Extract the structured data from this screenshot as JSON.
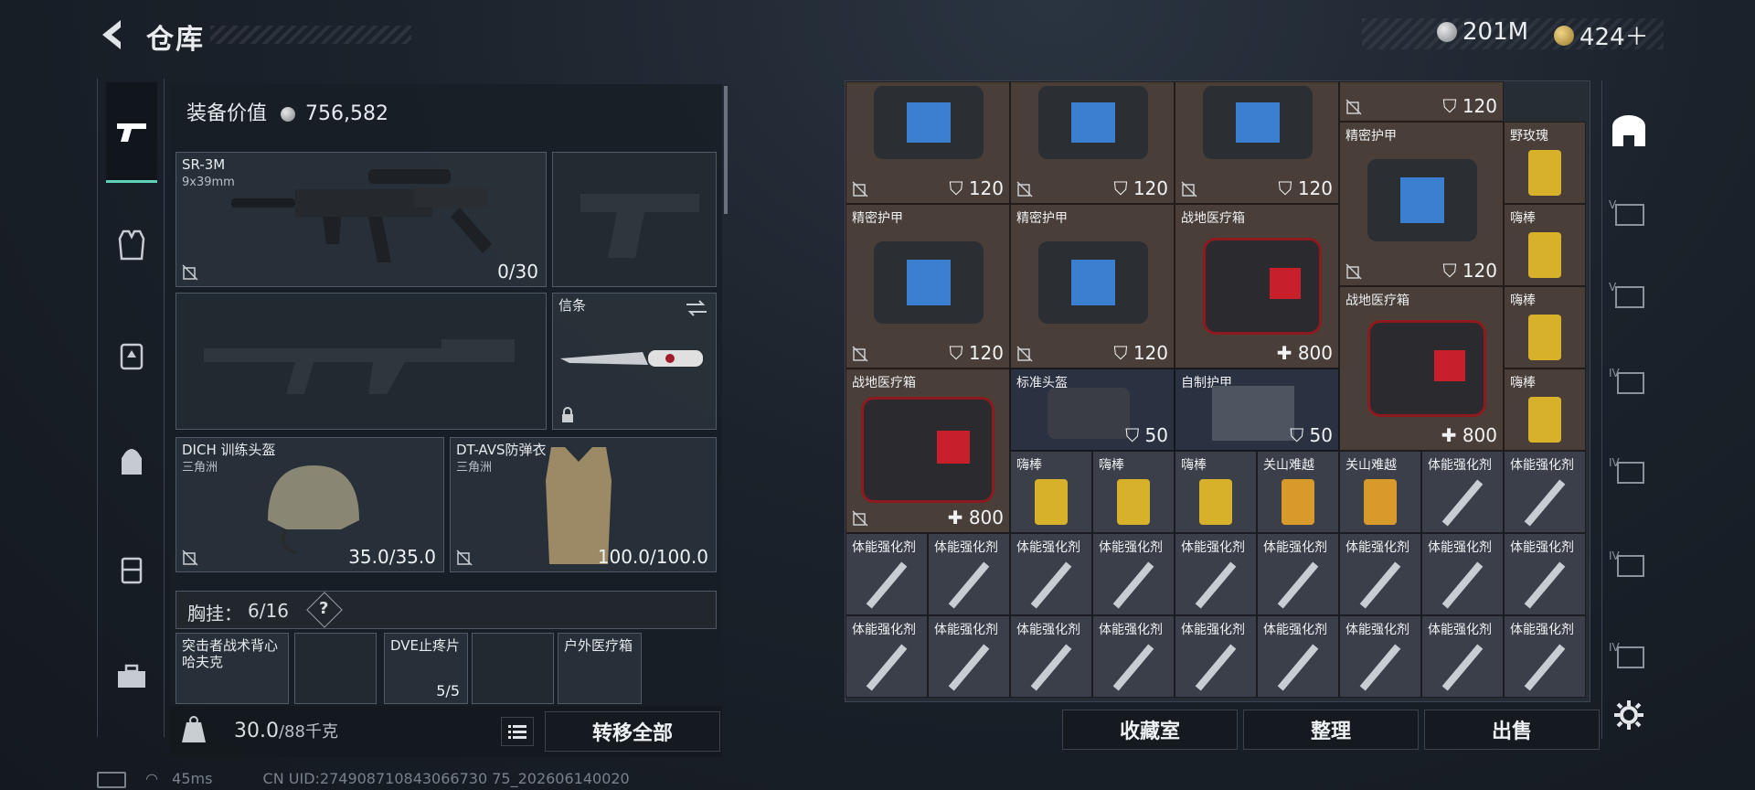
{
  "header": {
    "title": "仓库"
  },
  "currency": {
    "silver": "201M",
    "gold": "424＋"
  },
  "equipment": {
    "value_label": "装备价值",
    "value": "756,582",
    "primary": {
      "name": "SR-3M",
      "caliber": "9x39mm",
      "ammo": "0/30"
    },
    "melee": {
      "label": "信条"
    },
    "helmet": {
      "name": "DICH 训练头盔",
      "brand": "三角洲",
      "durability": "35.0/35.0"
    },
    "armor": {
      "name": "DT-AVS防弹衣",
      "brand": "三角洲",
      "durability": "100.0/100.0"
    },
    "chest_rig": {
      "label": "胸挂：",
      "count": "6/16",
      "help": "?"
    },
    "backpack": {
      "name": "突击者战术背心",
      "brand": "哈夫克"
    },
    "pouch_items": [
      {
        "name": "DVE止疼片",
        "count": "5/5"
      },
      {
        "name": "户外医疗箱"
      }
    ]
  },
  "weight": {
    "current": "30.0",
    "max": "/88千克",
    "transfer_all": "转移全部"
  },
  "stash": {
    "items": [
      {
        "name": "",
        "value": "120"
      },
      {
        "name": "",
        "value": "120"
      },
      {
        "name": "",
        "value": "120"
      },
      {
        "name": "",
        "value": "120"
      },
      {
        "name": "精密护甲",
        "value": "120"
      },
      {
        "name": "野玫瑰"
      },
      {
        "name": "精密护甲",
        "value": "120"
      },
      {
        "name": "精密护甲",
        "value": "120"
      },
      {
        "name": "战地医疗箱",
        "value": "800"
      },
      {
        "name": "嗨棒"
      },
      {
        "name": "战地医疗箱",
        "value": "800"
      },
      {
        "name": "嗨棒"
      },
      {
        "name": "战地医疗箱",
        "value": "800"
      },
      {
        "name": "标准头盔",
        "value": "50"
      },
      {
        "name": "自制护甲",
        "value": "50"
      },
      {
        "name": "嗨棒"
      },
      {
        "name": "嗨棒"
      },
      {
        "name": "嗨棒"
      },
      {
        "name": "嗨棒"
      },
      {
        "name": "关山难越"
      },
      {
        "name": "关山难越"
      },
      {
        "name": "体能强化剂"
      }
    ],
    "stim_label": "体能强化剂"
  },
  "bottom_buttons": {
    "collection": "收藏室",
    "organize": "整理",
    "sell": "出售"
  },
  "status": {
    "ping": "45ms",
    "uid": "CN UID:274908710843066730 75_202606140020"
  },
  "colors": {
    "accent": "#5fd3b7",
    "cell_brown": "#4a3f38",
    "cell_blue": "#2a3140"
  }
}
